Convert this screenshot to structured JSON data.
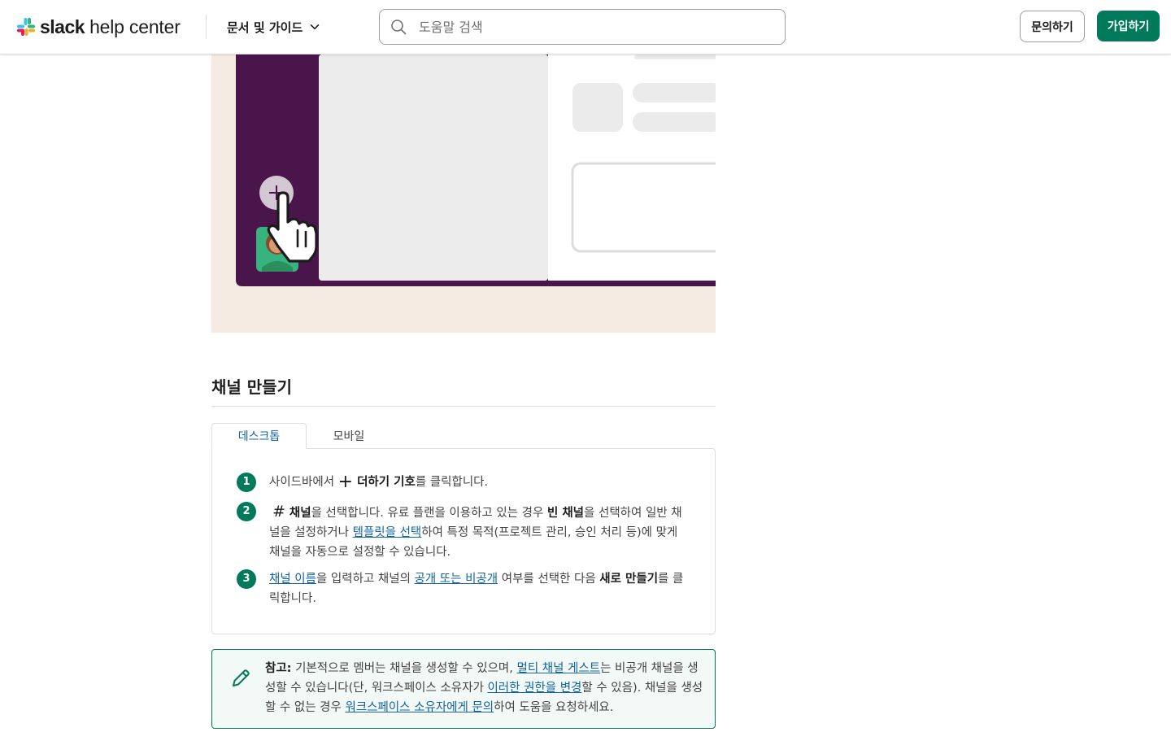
{
  "header": {
    "logo_bold": "slack",
    "logo_rest": "help center",
    "docs_menu_label": "문서 및 가이드",
    "search_placeholder": "도움말 검색",
    "contact_label": "문의하기",
    "signup_label": "가입하기"
  },
  "section": {
    "title": "채널 만들기",
    "tabs": [
      {
        "label": "데스크톱",
        "active": true
      },
      {
        "label": "모바일",
        "active": false
      }
    ]
  },
  "steps": [
    {
      "number": "1",
      "before": "사이드바에서 ",
      "icon": "plus-icon",
      "glyph": "+",
      "bold": "더하기 기호",
      "after": "를 클릭합니다."
    },
    {
      "number": "2",
      "icon": "hash-icon",
      "glyph": "#",
      "bold1": "채널",
      "text1": "을 선택합니다. 유료 플랜을 이용하고 있는 경우 ",
      "bold2": "빈 채널",
      "text2": "을 선택하여 일반 채널을 설정하거나 ",
      "link": "템플릿을 선택",
      "text3": "하여 특정 목적(프로젝트 관리, 승인 처리 등)에 맞게 채널을 자동으로 설정할 수 있습니다."
    },
    {
      "number": "3",
      "link1": "채널 이름",
      "text1": "을 입력하고 채널의 ",
      "link2": "공개 또는 비공개",
      "text2": " 여부를 선택한 다음 ",
      "bold": "새로 만들기",
      "text3": "를 클릭합니다."
    }
  ],
  "note": {
    "icon": "pencil-icon",
    "label": "참고:",
    "text1": " 기본적으로 멤버는 채널을 생성할 수 있으며, ",
    "link1": "멀티 채널 게스트",
    "text2": "는 비공개 채널을 생성할 수 있습니다(단, 워크스페이스 소유자가 ",
    "link2": "이러한 권한을 변경",
    "text3": "할 수 있음). 채널을 생성할 수 없는 경우 ",
    "link3": "워크스페이스 소유자에게 문의",
    "text4": "하여 도움을 요청하세요."
  },
  "colors": {
    "brand_green": "#007a5a",
    "link_blue": "#1264a3",
    "aubergine": "#4a154b",
    "illustration_bg": "#f5ebe2"
  }
}
